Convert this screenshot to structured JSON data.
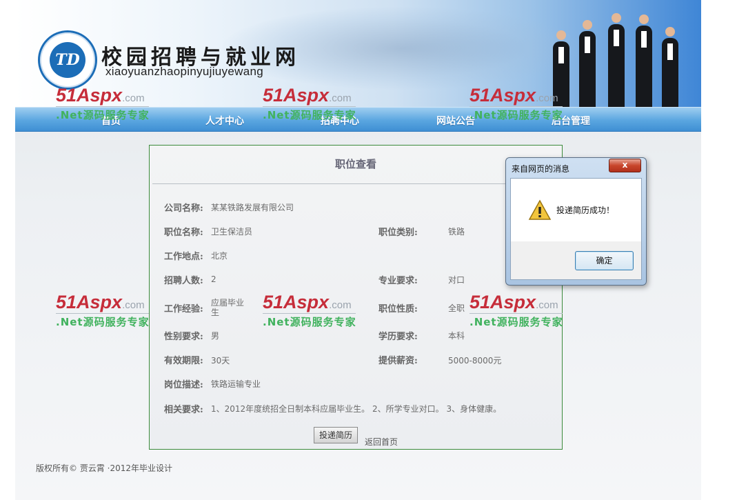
{
  "site": {
    "title": "校园招聘与就业网",
    "subtitle": "xiaoyuanzhaopinyujiuyewang",
    "logo_text": "TD"
  },
  "nav": {
    "items": [
      {
        "label": "首页"
      },
      {
        "label": "人才中心"
      },
      {
        "label": "招聘中心"
      },
      {
        "label": "网站公告"
      },
      {
        "label": "后台管理"
      }
    ]
  },
  "watermark": {
    "brand": "51Aspx",
    "domain": ".com",
    "tagline": ".Net源码服务专家"
  },
  "panel": {
    "title": "职位查看",
    "fields": {
      "company": {
        "label": "公司名称:",
        "value": "某某铁路发展有限公司"
      },
      "position": {
        "label": "职位名称:",
        "value": "卫生保洁员"
      },
      "category": {
        "label": "职位类别:",
        "value": "铁路"
      },
      "location": {
        "label": "工作地点:",
        "value": "北京"
      },
      "headcount": {
        "label": "招聘人数:",
        "value": "2"
      },
      "major": {
        "label": "专业要求:",
        "value": "对口"
      },
      "experience": {
        "label": "工作经验:",
        "value_line1": "应届毕业",
        "value_line2": "生"
      },
      "nature": {
        "label": "职位性质:",
        "value": "全职"
      },
      "gender": {
        "label": "性别要求:",
        "value": "男"
      },
      "education": {
        "label": "学历要求:",
        "value": "本科"
      },
      "validity": {
        "label": "有效期限:",
        "value": "30天"
      },
      "salary": {
        "label": "提供薪资:",
        "value": "5000-8000元"
      },
      "description": {
        "label": "岗位描述:",
        "value": "铁路运输专业"
      },
      "requirements": {
        "label": "相关要求:",
        "value": "1、2012年度统招全日制本科应届毕业生。 2、所学专业对口。 3、身体健康。"
      }
    },
    "apply_button": "投递简历",
    "back_link": "返回首页"
  },
  "footer": {
    "text": "版权所有© 贾云霄 ·2012年毕业设计"
  },
  "dialog": {
    "title": "来自网页的消息",
    "close_symbol": "x",
    "message": "投递简历成功！",
    "ok_button": "确定",
    "icon": "warning-icon"
  }
}
